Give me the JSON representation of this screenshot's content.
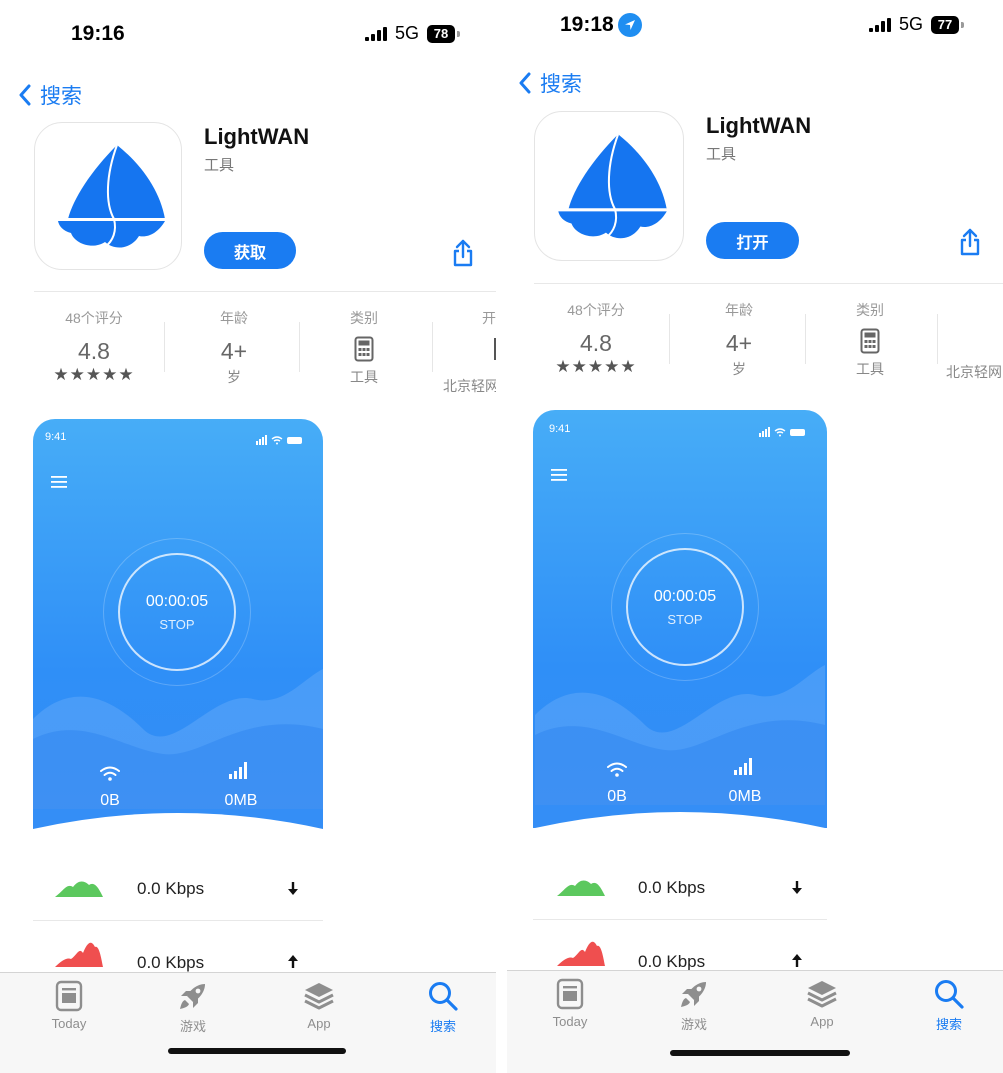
{
  "panels": [
    {
      "status_time": "19:16",
      "network": "5G",
      "battery": "78",
      "back_label": "搜索",
      "app_name": "LightWAN",
      "category": "工具",
      "action_label": "获取",
      "ratings_count": "48个评分",
      "rating_value": "4.8",
      "stars": "★★★★★",
      "age_label": "年龄",
      "age_value": "4+",
      "age_unit": "岁",
      "type_label": "类别",
      "type_value": "工具",
      "dev_label_partial": "开",
      "dev_value_partial": "北京轻网",
      "screenshot": {
        "time": "9:41",
        "timer": "00:00:05",
        "stop": "STOP",
        "wifi_data": "0B",
        "cell_data": "0MB",
        "download_speed": "0.0 Kbps",
        "upload_speed": "0.0 Kbps",
        "download_color": "#5cc85e",
        "upload_color": "#ef4f4f"
      },
      "tabs": [
        "Today",
        "游戏",
        "App",
        "搜索"
      ]
    },
    {
      "status_time": "19:18",
      "network": "5G",
      "battery": "77",
      "back_label": "搜索",
      "app_name": "LightWAN",
      "category": "工具",
      "action_label": "打开",
      "ratings_count": "48个评分",
      "rating_value": "4.8",
      "stars": "★★★★★",
      "age_label": "年龄",
      "age_value": "4+",
      "age_unit": "岁",
      "type_label": "类别",
      "type_value": "工具",
      "dev_value_partial": "北京轻网",
      "screenshot": {
        "time": "9:41",
        "timer": "00:00:05",
        "stop": "STOP",
        "wifi_data": "0B",
        "cell_data": "0MB",
        "download_speed": "0.0 Kbps",
        "upload_speed": "0.0 Kbps",
        "download_color": "#5cc85e",
        "upload_color": "#ef4f4f"
      },
      "tabs": [
        "Today",
        "游戏",
        "App",
        "搜索"
      ]
    }
  ],
  "colors": {
    "accent": "#1a7cf2",
    "app_blue": "#1575f0"
  }
}
